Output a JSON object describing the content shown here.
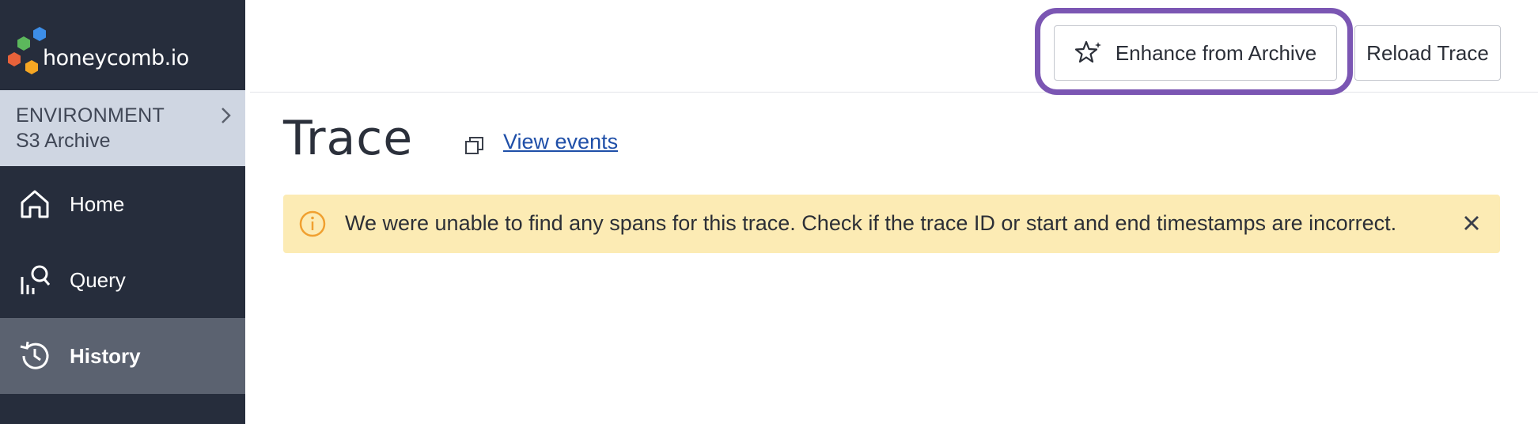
{
  "brand": {
    "logo_text": "honeycomb.io"
  },
  "environment": {
    "label": "ENVIRONMENT",
    "value": "S3 Archive"
  },
  "sidebar": {
    "items": [
      {
        "label": "Home",
        "icon": "home-icon"
      },
      {
        "label": "Query",
        "icon": "query-icon"
      },
      {
        "label": "History",
        "icon": "history-icon",
        "active": true
      }
    ]
  },
  "toolbar": {
    "enhance_label": "Enhance from Archive",
    "reload_label": "Reload Trace"
  },
  "main": {
    "title": "Trace",
    "view_events_link": "View events"
  },
  "alert": {
    "message": "We were unable to find any spans for this trace. Check if the trace ID or start and end timestamps are incorrect."
  },
  "colors": {
    "sidebar_bg": "#262d3c",
    "env_bg": "#cfd6e2",
    "active_nav_bg": "#5b6270",
    "alert_bg": "#fcebb4",
    "alert_icon": "#f0a030",
    "highlight_ring": "#7b56b3",
    "link": "#1f4fa8"
  }
}
